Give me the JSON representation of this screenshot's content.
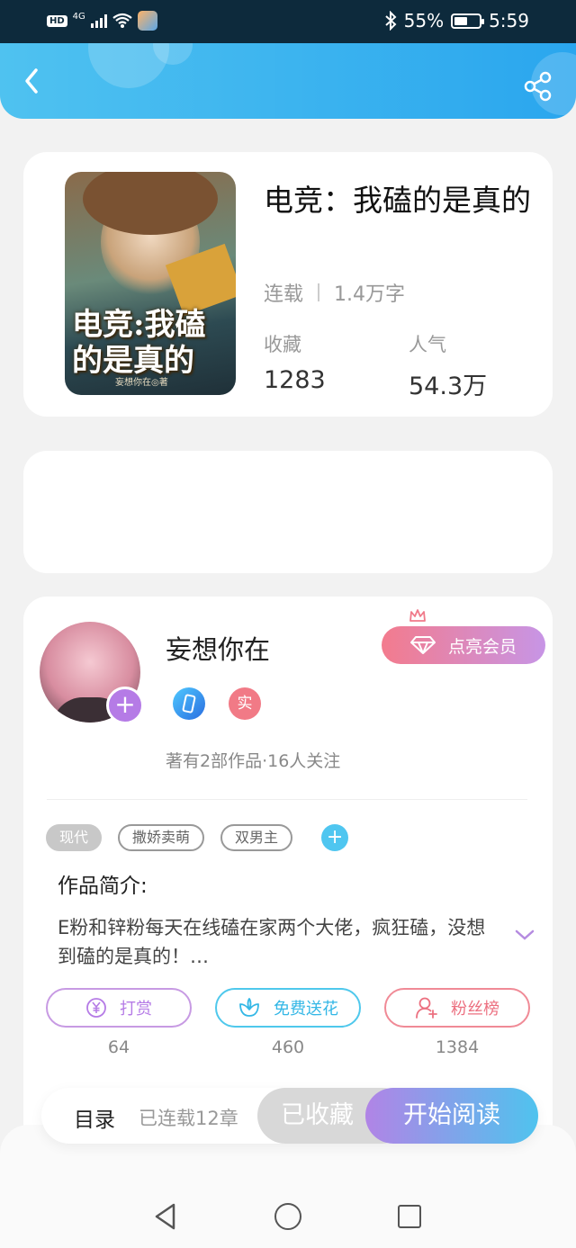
{
  "status_bar": {
    "network": "4G",
    "battery_text": "55%",
    "battery_level": 0.55,
    "time": "5:59"
  },
  "book": {
    "title": "电竞：我磕的是真的",
    "cover_title": "电竞:我磕的是真的",
    "cover_author": "妄想你在◎著",
    "status": "连载",
    "word_count": "1.4万字",
    "stats": [
      {
        "label": "收藏",
        "value": "1283"
      },
      {
        "label": "人气",
        "value": "54.3万"
      }
    ]
  },
  "author": {
    "name": "妄想你在",
    "vip_label": "点亮会员",
    "real_badge": "实",
    "summary": "著有2部作品·16人关注"
  },
  "tags": [
    "现代",
    "撒娇卖萌",
    "双男主"
  ],
  "intro": {
    "title": "作品简介:",
    "text": "E粉和锌粉每天在线磕在家两个大佬，疯狂磕，没想到磕的是真的！…"
  },
  "actions": [
    {
      "label": "打赏",
      "count": "64"
    },
    {
      "label": "免费送花",
      "count": "460"
    },
    {
      "label": "粉丝榜",
      "count": "1384"
    }
  ],
  "reader_bar": {
    "toc_label": "目录",
    "chapter_label": "已连载12章",
    "collected_label": "已收藏",
    "read_label": "开始阅读"
  },
  "colors": {
    "header": "#2aa6ee",
    "accent_purple": "#b57be6",
    "accent_blue": "#4fc8ec",
    "accent_pink": "#ec7080"
  },
  "icons": [
    "back-icon",
    "share-icon",
    "diamond-icon",
    "crown-icon",
    "yen-icon",
    "flower-icon",
    "user-icon",
    "chevron-down-icon",
    "plus-icon"
  ]
}
